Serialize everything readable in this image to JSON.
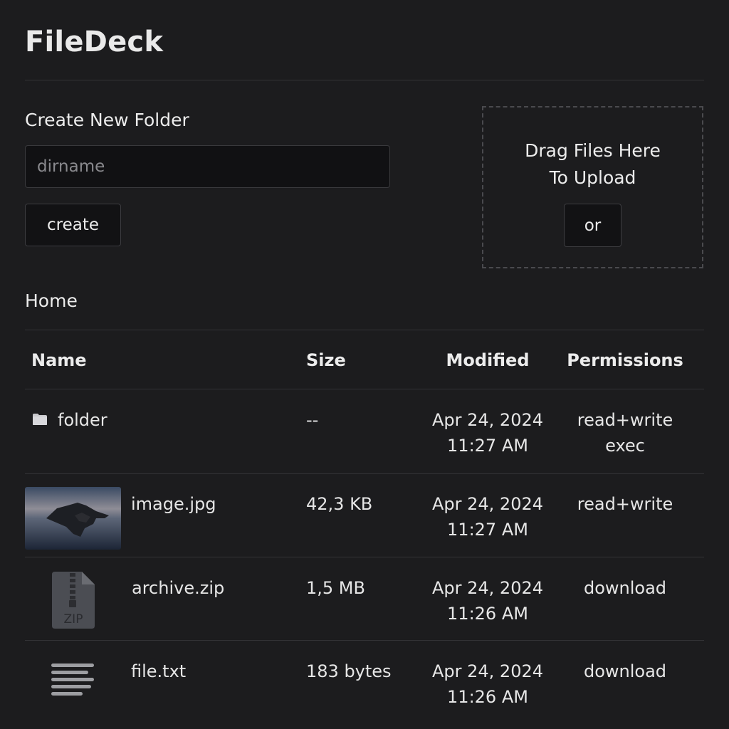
{
  "app": {
    "title": "FileDeck"
  },
  "create_folder": {
    "label": "Create New Folder",
    "input_placeholder": "dirname",
    "input_value": "",
    "button_label": "create"
  },
  "upload": {
    "line1": "Drag Files Here",
    "line2": "To Upload",
    "or_button": "or"
  },
  "breadcrumb": "Home",
  "table": {
    "headers": {
      "name": "Name",
      "size": "Size",
      "modified": "Modified",
      "permissions": "Permissions"
    },
    "rows": [
      {
        "icon": "folder-icon",
        "name": "folder",
        "size": "--",
        "date": "Apr 24, 2024",
        "time": "11:27 AM",
        "perm1": "read+write",
        "perm2": "exec"
      },
      {
        "icon": "image-thumbnail",
        "name": "image.jpg",
        "size": "42,3 KB",
        "date": "Apr 24, 2024",
        "time": "11:27 AM",
        "perm1": "read+write",
        "perm2": ""
      },
      {
        "icon": "zip-file-icon",
        "icon_label": "ZIP",
        "name": "archive.zip",
        "size": "1,5 MB",
        "date": "Apr 24, 2024",
        "time": "11:26 AM",
        "perm1": "download",
        "perm2": ""
      },
      {
        "icon": "text-file-icon",
        "name": "file.txt",
        "size": "183 bytes",
        "date": "Apr 24, 2024",
        "time": "11:26 AM",
        "perm1": "download",
        "perm2": ""
      }
    ]
  },
  "colors": {
    "background": "#1c1c1e",
    "input_bg": "#111113",
    "text": "#e6e6e6",
    "divider": "#333336"
  }
}
